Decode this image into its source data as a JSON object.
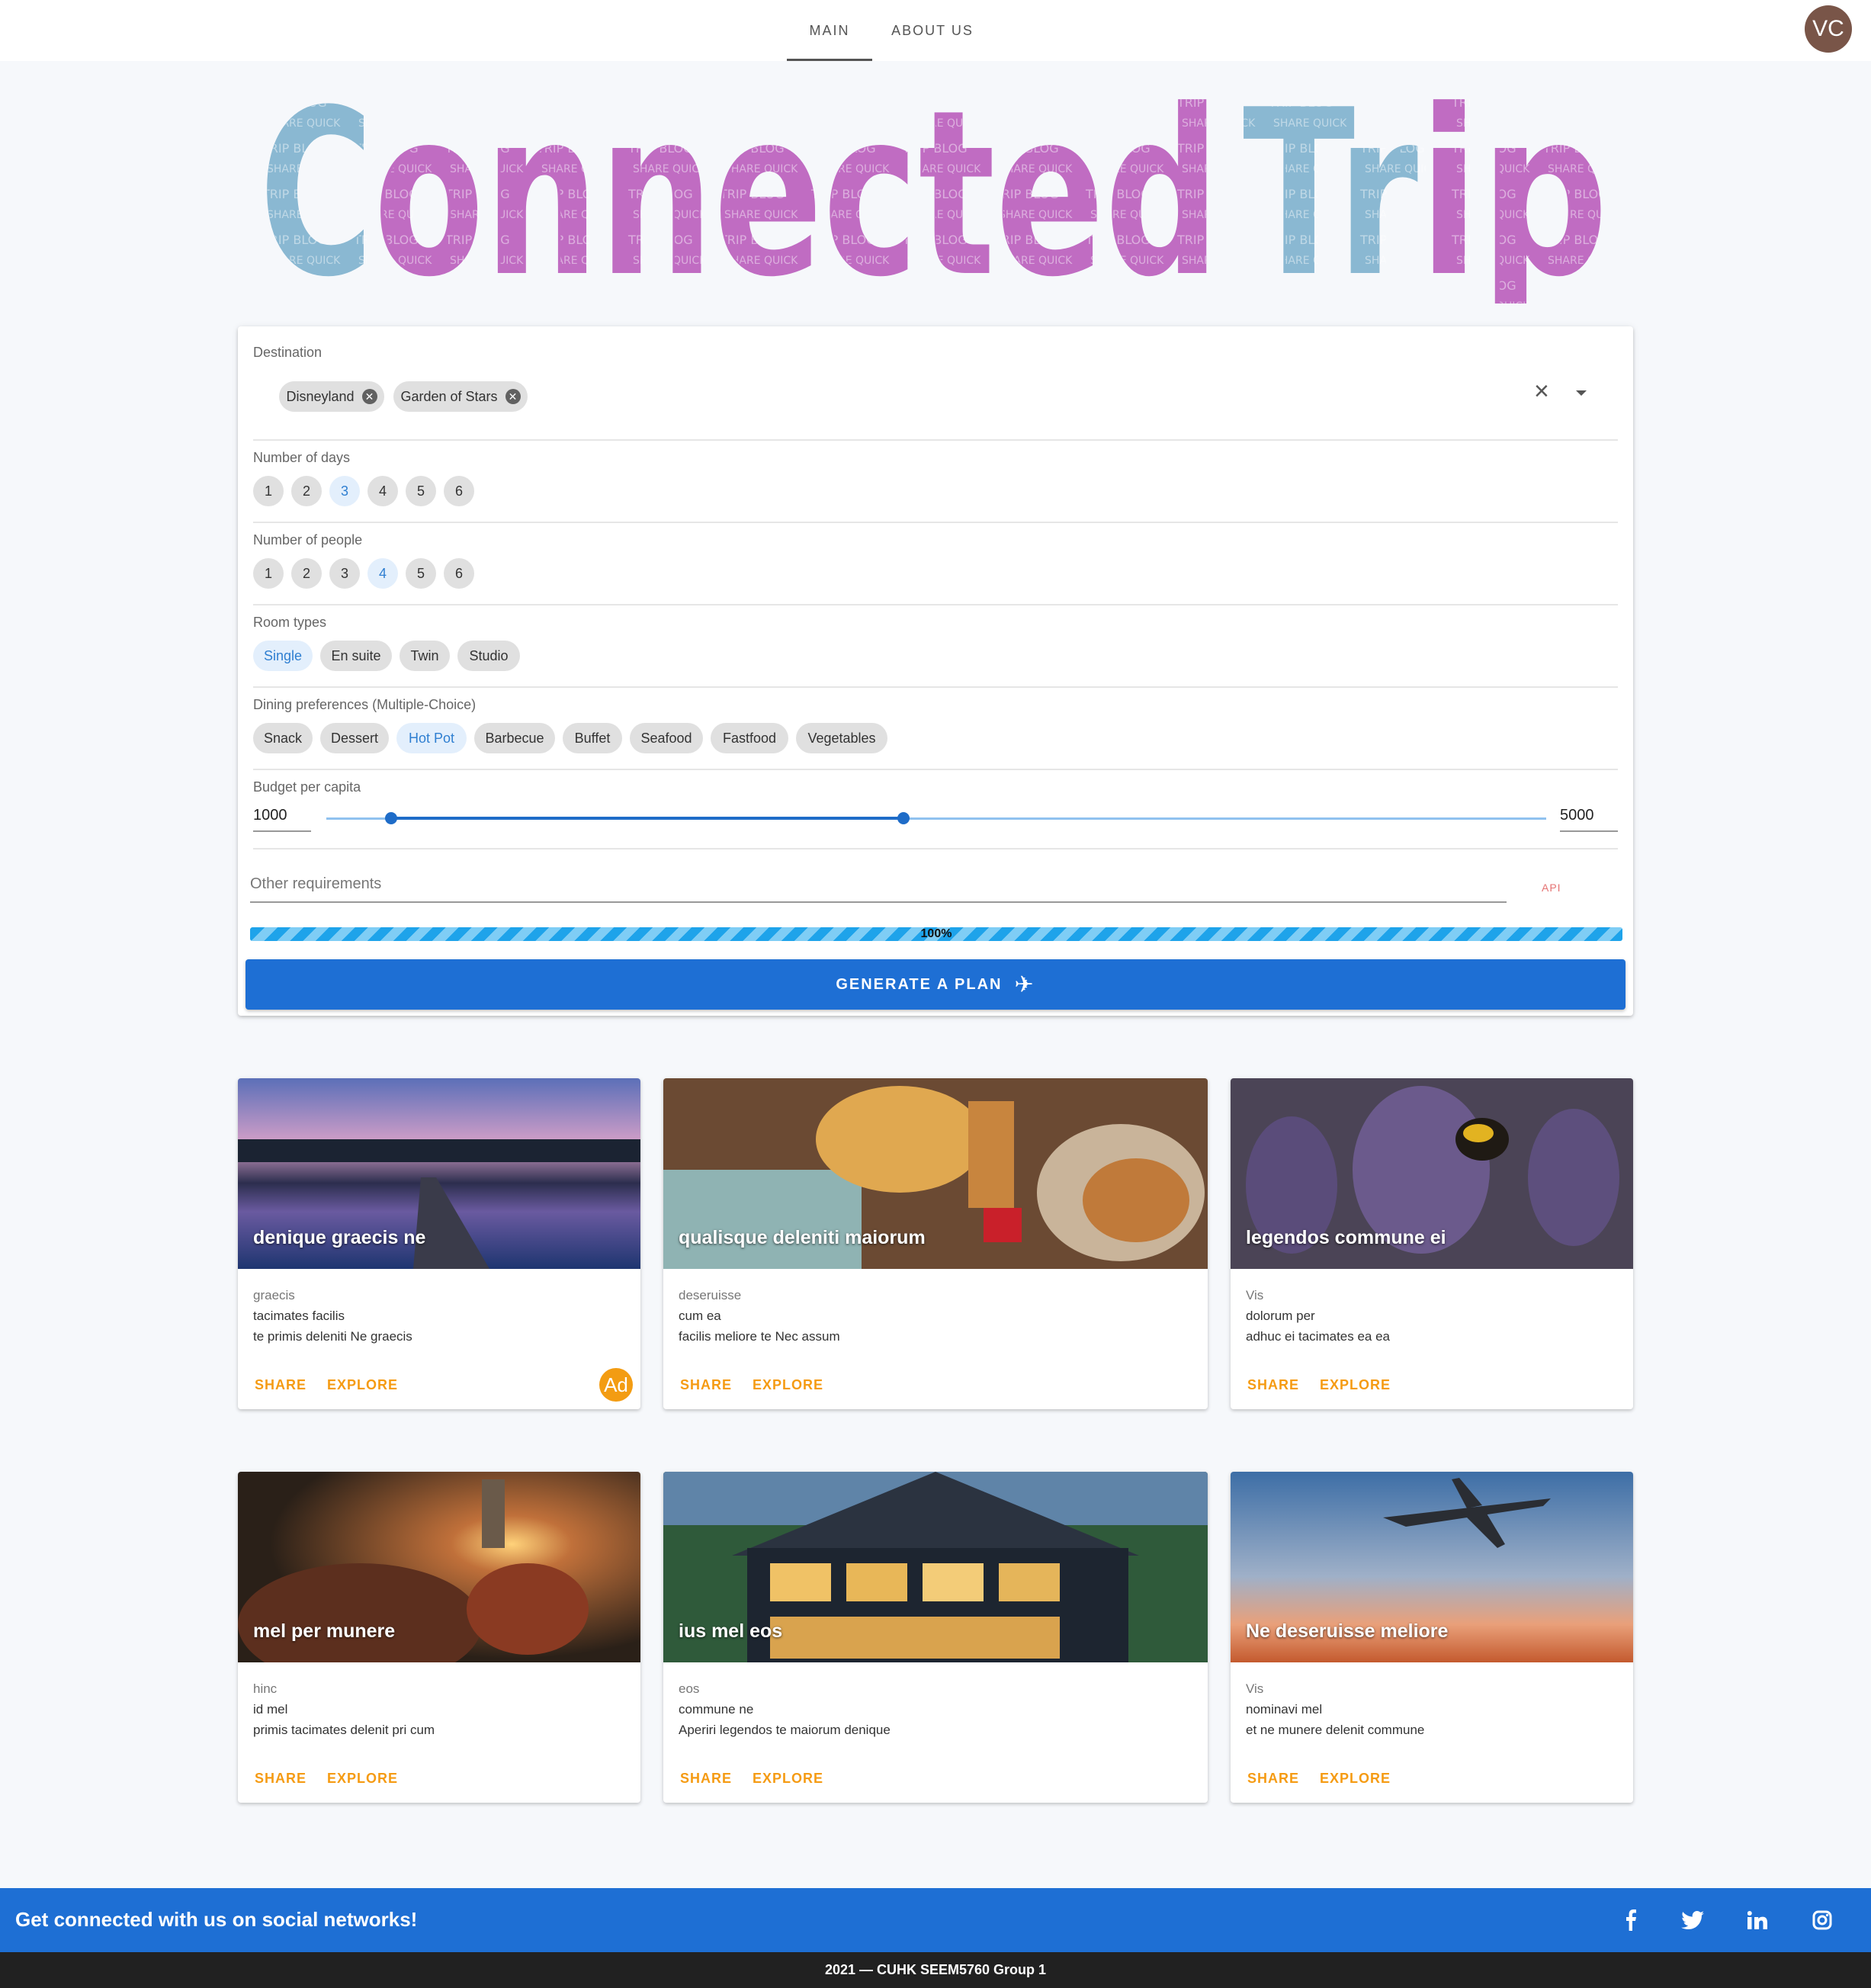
{
  "nav": {
    "tabs": [
      {
        "label": "MAIN",
        "active": true
      },
      {
        "label": "ABOUT US",
        "active": false
      }
    ],
    "avatar_initials": "VC"
  },
  "logo": {
    "text": "Connected Trip"
  },
  "form": {
    "destination": {
      "label": "Destination",
      "chips": [
        "Disneyland",
        "Garden of Stars"
      ]
    },
    "days": {
      "label": "Number of days",
      "options": [
        "1",
        "2",
        "3",
        "4",
        "5",
        "6"
      ],
      "selected": "3"
    },
    "people": {
      "label": "Number of people",
      "options": [
        "1",
        "2",
        "3",
        "4",
        "5",
        "6"
      ],
      "selected": "4"
    },
    "rooms": {
      "label": "Room types",
      "options": [
        "Single",
        "En suite",
        "Twin",
        "Studio"
      ],
      "selected": "Single"
    },
    "dining": {
      "label": "Dining preferences (Multiple-Choice)",
      "options": [
        "Snack",
        "Dessert",
        "Hot Pot",
        "Barbecue",
        "Buffet",
        "Seafood",
        "Fastfood",
        "Vegetables"
      ],
      "selected": [
        "Hot Pot"
      ]
    },
    "budget": {
      "label": "Budget per capita",
      "min": "1000",
      "max": "5000",
      "low_fraction": 0.053,
      "high_fraction": 0.473
    },
    "other_requirements": {
      "placeholder": "Other requirements",
      "api_label": "API"
    },
    "progress": {
      "value": 100,
      "label": "100%"
    },
    "generate_label": "Generate a plan"
  },
  "cards": [
    {
      "title": "denique graecis ne",
      "subtitle": "graecis",
      "line1": "tacimates facilis",
      "line2": "te primis deleniti Ne graecis",
      "share": "SHARE",
      "explore": "EXPLORE",
      "badge": "Ad"
    },
    {
      "title": "qualisque deleniti maiorum",
      "subtitle": "deseruisse",
      "line1": "cum ea",
      "line2": "facilis meliore te Nec assum",
      "share": "SHARE",
      "explore": "EXPLORE"
    },
    {
      "title": "legendos commune ei",
      "subtitle": "Vis",
      "line1": "dolorum per",
      "line2": "adhuc ei tacimates ea ea",
      "share": "SHARE",
      "explore": "EXPLORE"
    },
    {
      "title": "mel per munere",
      "subtitle": "hinc",
      "line1": "id mel",
      "line2": "primis tacimates delenit pri cum",
      "share": "SHARE",
      "explore": "EXPLORE"
    },
    {
      "title": "ius mel eos",
      "subtitle": "eos",
      "line1": "commune ne",
      "line2": "Aperiri legendos te maiorum denique",
      "share": "SHARE",
      "explore": "EXPLORE"
    },
    {
      "title": "Ne deseruisse meliore",
      "subtitle": "Vis",
      "line1": "nominavi mel",
      "line2": "et ne munere delenit commune",
      "share": "SHARE",
      "explore": "EXPLORE"
    }
  ],
  "footer": {
    "social_text": "Get connected with us on social networks!",
    "social_icons": [
      "facebook-icon",
      "twitter-icon",
      "linkedin-icon",
      "instagram-icon"
    ],
    "copyright": "2021 — CUHK SEEM5760 Group 1"
  },
  "colors": {
    "primary": "#1e6fd4",
    "accent": "#f59b13",
    "chip_selected": "#e3effc",
    "logo_blue": "#8ab8d2",
    "logo_purple": "#c06cc2"
  }
}
